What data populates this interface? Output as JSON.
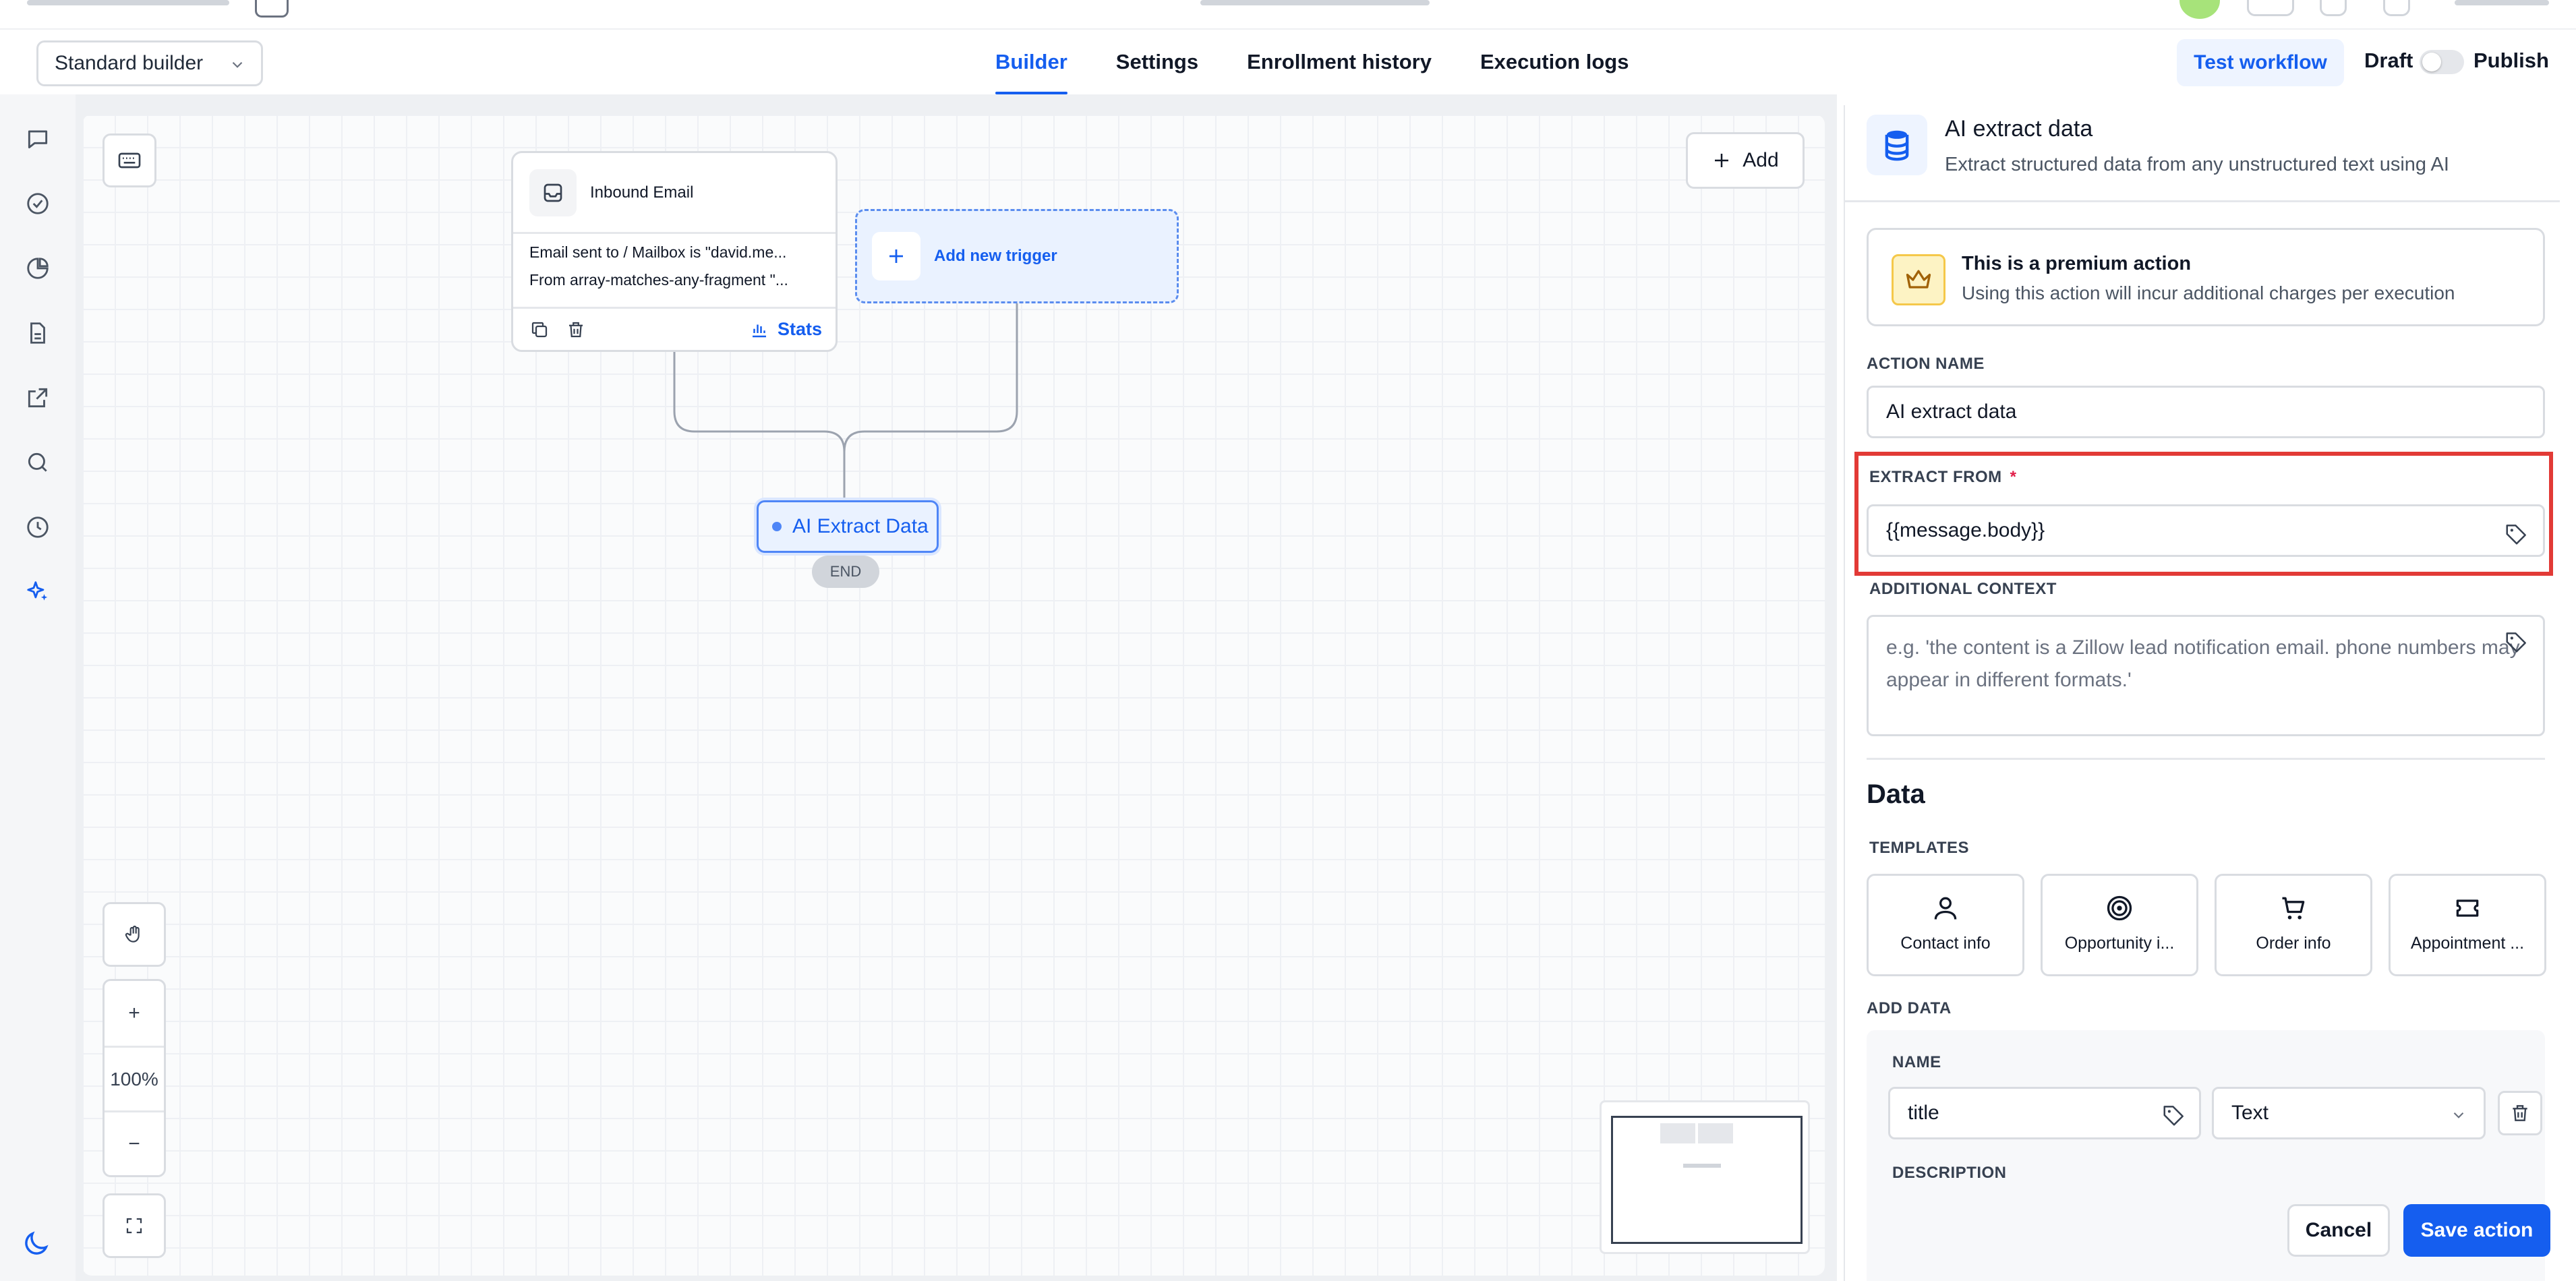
{
  "header": {
    "builder_select": "Standard builder",
    "tabs": [
      {
        "label": "Builder",
        "active": true
      },
      {
        "label": "Settings",
        "active": false
      },
      {
        "label": "Enrollment history",
        "active": false
      },
      {
        "label": "Execution logs",
        "active": false
      }
    ],
    "test_workflow": "Test workflow",
    "draft": "Draft",
    "publish": "Publish"
  },
  "canvas": {
    "add_button": "Add",
    "trigger": {
      "title": "Inbound Email",
      "lines": [
        "Email sent to / Mailbox is \"david.me...",
        "From array-matches-any-fragment \"..."
      ],
      "stats": "Stats"
    },
    "new_trigger": "Add new trigger",
    "action_node": "AI Extract Data",
    "end_label": "END",
    "zoom_level": "100%",
    "zoom_in": "+",
    "zoom_out": "−"
  },
  "panel": {
    "title": "AI extract data",
    "subtitle": "Extract structured data from any unstructured text using AI",
    "premium_title": "This is a premium action",
    "premium_subtitle": "Using this action will incur additional charges per execution",
    "action_name_label": "ACTION NAME",
    "action_name_value": "AI extract data",
    "extract_from_label": "EXTRACT FROM",
    "extract_from_required": "*",
    "extract_from_value": "{{message.body}}",
    "additional_context_label": "ADDITIONAL CONTEXT",
    "additional_context_placeholder": "e.g. 'the content is a Zillow lead notification email. phone numbers may appear in different formats.'",
    "data_title": "Data",
    "templates_label": "TEMPLATES",
    "templates": [
      "Contact info",
      "Opportunity i...",
      "Order info",
      "Appointment ..."
    ],
    "add_data_label": "ADD DATA",
    "field_name_label": "NAME",
    "field_name_value": "title",
    "field_type_value": "Text",
    "description_label": "DESCRIPTION",
    "cancel": "Cancel",
    "save": "Save action"
  },
  "colors": {
    "accent": "#155eef",
    "highlight": "#e23a36",
    "premium": "#f5c84a"
  }
}
